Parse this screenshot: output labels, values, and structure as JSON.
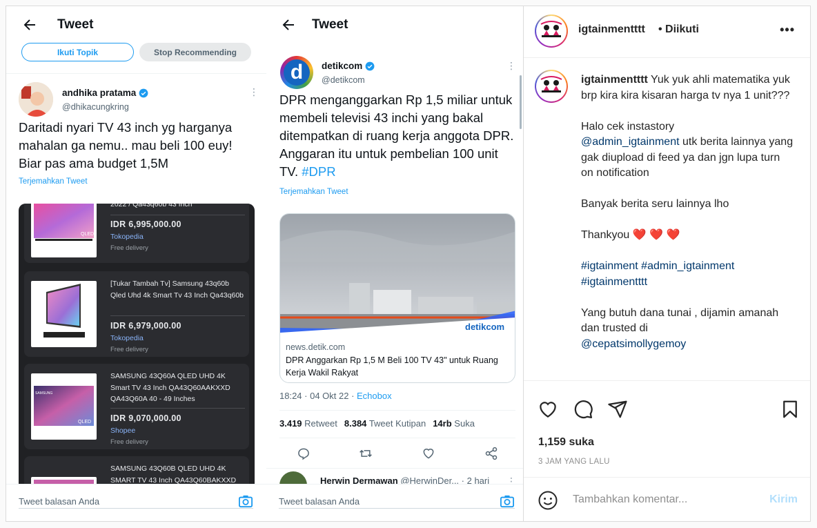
{
  "left": {
    "header": {
      "title": "Tweet"
    },
    "topic": {
      "follow_label": "Ikuti Topik",
      "stop_label": "Stop Recommending"
    },
    "tweet": {
      "name": "andhika pratama",
      "handle": "@dhikacungkring",
      "text": "Daritadi nyari TV 43 inch yg harganya mahalan ga nemu.. mau beli 100 euy! Biar pas ama budget 1,5M",
      "translate": "Terjemahkan Tweet"
    },
    "products": [
      {
        "title": "2022 / Qa43q60b 43 Inch",
        "price": "IDR 6,995,000.00",
        "store": "Tokopedia",
        "delivery": "Free delivery"
      },
      {
        "title": "[Tukar Tambah Tv] Samsung 43q60b Qled Uhd 4k Smart Tv 43 Inch Qa43q60b",
        "price": "IDR 6,979,000.00",
        "store": "Tokopedia",
        "delivery": "Free delivery"
      },
      {
        "title": "SAMSUNG 43Q60A QLED UHD 4K Smart TV 43 Inch QA43Q60AAKXXD QA43Q60A 40 - 49 Inches",
        "price": "IDR 9,070,000.00",
        "store": "Shopee",
        "delivery": "Free delivery"
      },
      {
        "title": "SAMSUNG 43Q60B QLED UHD 4K SMART TV 43 Inch QA43Q60BAKXXD"
      }
    ],
    "thumb_labels": {
      "qled": "QLED",
      "samsung": "SAMSUNG"
    },
    "reply_placeholder": "Tweet balasan Anda"
  },
  "mid": {
    "header": {
      "title": "Tweet"
    },
    "tweet": {
      "name": "detikcom",
      "handle": "@detikcom",
      "avatar_letter": "d",
      "text": "DPR menganggarkan Rp 1,5 miliar untuk membeli televisi 43 inchi yang bakal ditempatkan di ruang kerja anggota DPR. Anggaran itu untuk pembelian 100 unit TV.",
      "hashtag": "#DPR",
      "translate": "Terjemahkan Tweet"
    },
    "link": {
      "watermark": "detikcom",
      "domain": "news.detik.com",
      "title": "DPR Anggarkan Rp 1,5 M Beli 100 TV 43\" untuk Ruang Kerja Wakil Rakyat"
    },
    "meta": {
      "time": "18:24 · 04 Okt 22 · ",
      "source": "Echobox"
    },
    "stats": {
      "retweets": "3.419",
      "retweets_label": "Retweet",
      "quotes": "8.384",
      "quotes_label": "Tweet Kutipan",
      "likes": "14rb",
      "likes_label": "Suka"
    },
    "next": {
      "name": "Herwin Dermawan",
      "handle": "@HerwinDer...",
      "time": "· 2 hari"
    },
    "reply_placeholder": "Tweet balasan Anda"
  },
  "ig": {
    "username": "igtainmentttt",
    "follow_status": "• Diikuti",
    "caption": {
      "username": "igtainmentttt",
      "line1": " Yuk yuk ahli matematika yuk",
      "line2": "brp kira kira kisaran harga tv nya 1 unit???",
      "line3a": "Halo cek instastory",
      "mention": "@admin_igtainment",
      "line3b": " utk berita lainnya yang gak diupload di feed ya dan jgn lupa turn on notification",
      "line4": "Banyak berita seru lainnya lho",
      "line5": "Thankyou ❤️ ❤️ ❤️",
      "tag1": "#igtainment",
      "tag2": "#admin_igtainment",
      "tag3": "#igtainmentttt",
      "line6a": "Yang butuh dana tunai , dijamin amanah dan trusted di",
      "mention2": "@cepatsimollygemoy"
    },
    "likes": "1,159 suka",
    "time": "3 JAM YANG LALU",
    "comment_placeholder": "Tambahkan komentar...",
    "send_label": "Kirim"
  },
  "colors": {
    "twitter_blue": "#1d9bf0",
    "ig_link": "#00376b",
    "heart": "#ed4956"
  }
}
